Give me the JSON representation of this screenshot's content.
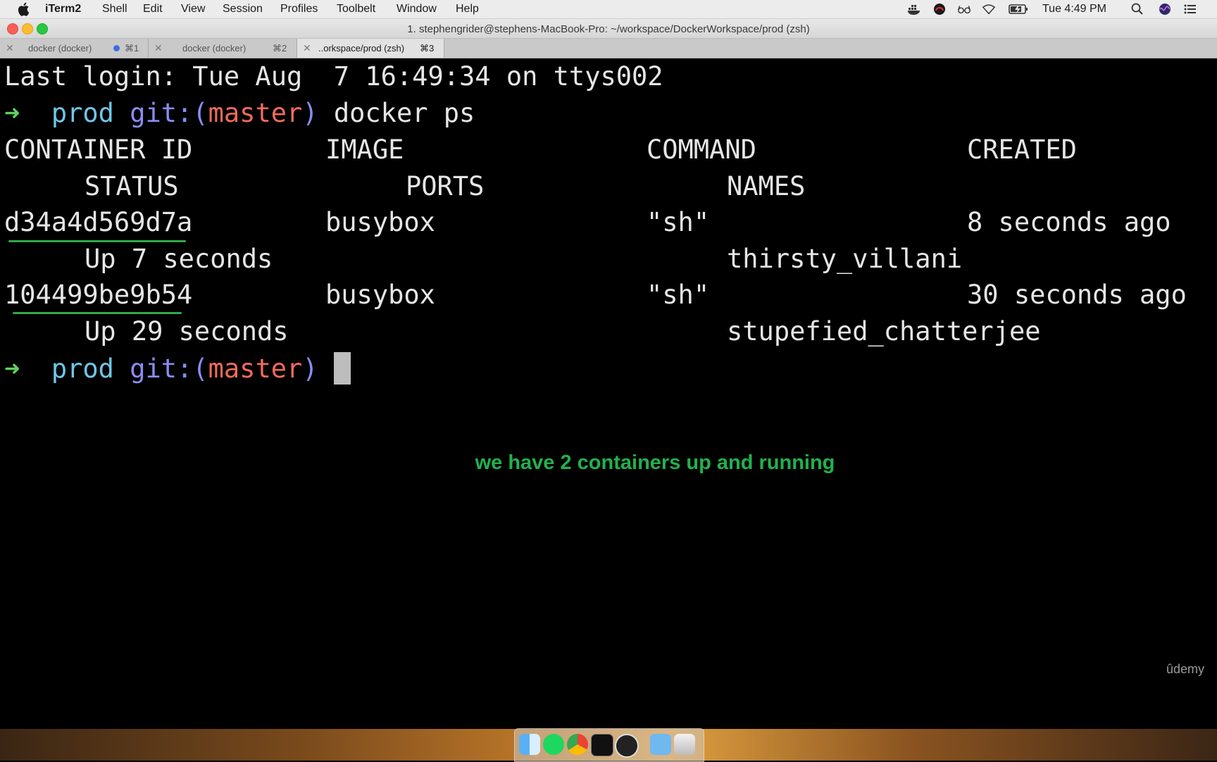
{
  "menubar": {
    "app_name": "iTerm2",
    "menus": [
      "Shell",
      "Edit",
      "View",
      "Session",
      "Profiles",
      "Toolbelt",
      "Window",
      "Help"
    ],
    "clock": "Tue 4:49 PM",
    "status_icons": [
      "docker-icon",
      "creative-cloud-icon",
      "glasses-icon",
      "wifi-icon",
      "battery-icon",
      "search-icon",
      "siri-icon",
      "notification-center-icon"
    ]
  },
  "window": {
    "title": "1. stephengrider@stephens-MacBook-Pro: ~/workspace/DockerWorkspace/prod (zsh)"
  },
  "tabs": [
    {
      "label": "docker (docker)",
      "shortcut": "⌘1",
      "active": false,
      "activity_dot": true
    },
    {
      "label": "docker (docker)",
      "shortcut": "⌘2",
      "active": false,
      "activity_dot": false
    },
    {
      "label": "..orkspace/prod (zsh)",
      "shortcut": "⌘3",
      "active": true,
      "activity_dot": false
    }
  ],
  "terminal": {
    "last_login": "Last login: Tue Aug  7 16:49:34 on ttys002",
    "prompt": {
      "arrow": "➜",
      "dir": "prod",
      "git_prefix": "git:(",
      "branch": "master",
      "git_suffix": ")"
    },
    "command": "docker ps",
    "headers": {
      "container_id": "CONTAINER ID",
      "image": "IMAGE",
      "command": "COMMAND",
      "created": "CREATED",
      "status": "STATUS",
      "ports": "PORTS",
      "names": "NAMES"
    },
    "containers": [
      {
        "id": "d34a4d569d7a",
        "image": "busybox",
        "command": "\"sh\"",
        "created": "8 seconds ago",
        "status": "Up 7 seconds",
        "names": "thirsty_villani"
      },
      {
        "id": "104499be9b54",
        "image": "busybox",
        "command": "\"sh\"",
        "created": "30 seconds ago",
        "status": "Up 29 seconds",
        "names": "stupefied_chatterjee"
      }
    ]
  },
  "annotation": "we have 2 containers up and running",
  "watermark": "ûdemy",
  "colors": {
    "prompt_arrow": "#5fd35f",
    "dir": "#6fc6e8",
    "git": "#8a8df2",
    "branch": "#ef6b5b",
    "annotation": "#22b14c"
  },
  "dock": {
    "icons": [
      "finder-icon",
      "spotify-icon",
      "chrome-icon",
      "terminal-icon",
      "obs-icon",
      "folder-icon",
      "trash-icon"
    ]
  }
}
